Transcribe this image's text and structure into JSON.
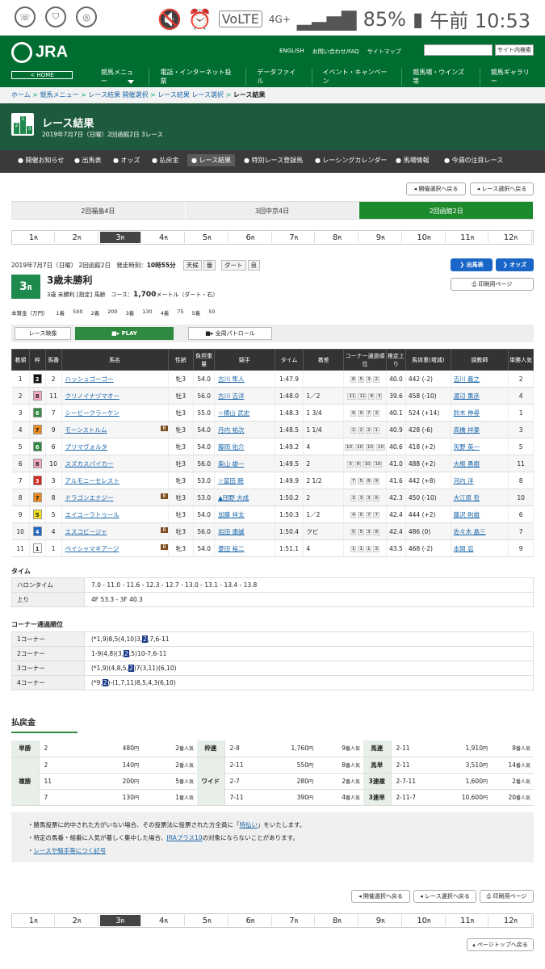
{
  "status": {
    "battery": "85%",
    "time": "午前 10:53",
    "net": "4G+",
    "volte": "VoLTE"
  },
  "header": {
    "logo": "JRA",
    "home": "< HOME",
    "links": [
      "ENGLISH",
      "お問い合わせ/FAQ",
      "サイトマップ"
    ],
    "search_btn": "サイト内検索",
    "nav": [
      "競馬メニュー",
      "電話・インターネット投票",
      "データファイル",
      "イベント・キャンペーン",
      "競馬場・ウインズ等",
      "競馬ギャラリー"
    ]
  },
  "breadcrumb": [
    "ホーム",
    "競馬メニュー",
    "レース結果 開催選択",
    "レース結果 レース選択",
    "レース結果"
  ],
  "page": {
    "title": "レース結果",
    "subtitle": "2019年7月7日（日曜）2回函館2日 3レース"
  },
  "subnav": [
    "開催お知らせ",
    "出馬表",
    "オッズ",
    "払戻金",
    "レース結果",
    "特別レース登録馬",
    "レーシングカレンダー",
    "馬場情報",
    "今週の注目レース"
  ],
  "nav_buttons": {
    "meet_back": "開催選択へ戻る",
    "race_back": "レース選択へ戻る",
    "print": "印刷用ページ",
    "page_top": "ページトップへ戻る"
  },
  "meetings": [
    "2回福島4日",
    "3回中京4日",
    "2回函館2日"
  ],
  "races": [
    "1",
    "2",
    "3",
    "4",
    "5",
    "6",
    "7",
    "8",
    "9",
    "10",
    "11",
    "12"
  ],
  "race_suffix": "R",
  "race": {
    "date_info": "2019年7月7日（日曜） 2回函館2日",
    "start_label": "発走時刻：",
    "start_time": "10時55分",
    "weather_label": "天候",
    "weather": "曇",
    "track_label": "ダート",
    "going": "良",
    "num": "3",
    "num_suffix": "R",
    "name": "3歳未勝利",
    "cond": "3歳 未勝利 [指定] 馬齢",
    "course_label": "コース：",
    "course": "1,700",
    "course_unit": "メートル（ダート・右）",
    "btn_entries": "出馬表",
    "btn_odds": "オッズ",
    "btn_print": "印刷用ページ"
  },
  "prizes": [
    "本賞金（万円）",
    "1着",
    "500",
    "2着",
    "200",
    "3着",
    "130",
    "4着",
    "75",
    "5着",
    "50"
  ],
  "video": {
    "label": "レース映像",
    "play": "PLAY",
    "patrol": "全周パトロール"
  },
  "table_headers": [
    "着順",
    "枠",
    "馬番",
    "馬名",
    "性齢",
    "負担重量",
    "騎手",
    "タイム",
    "着差",
    "コーナー通過順位",
    "推定上り",
    "馬体重(増減)",
    "調教師",
    "単勝人気"
  ],
  "results": [
    {
      "pos": "1",
      "waku": "2",
      "num": "2",
      "horse": "ハッシュゴーゴー",
      "b": "",
      "sex": "牝3",
      "wt": "54.0",
      "jockey": "古川 隼人",
      "time": "1:47.9",
      "margin": "",
      "corners": [
        "8",
        "5",
        "3",
        "2"
      ],
      "last": "40.0",
      "bw": "442 (-2)",
      "trainer": "吉川 義之",
      "pop": "2"
    },
    {
      "pos": "2",
      "waku": "8",
      "num": "11",
      "horse": "クリノイナヅマオー",
      "b": "",
      "sex": "牡3",
      "wt": "56.0",
      "jockey": "古川 吉洋",
      "time": "1:48.0",
      "margin": "1／2",
      "corners": [
        "11",
        "11",
        "8",
        "3"
      ],
      "last": "39.6",
      "bw": "458 (-10)",
      "trainer": "渡辺 薫彦",
      "pop": "4"
    },
    {
      "pos": "3",
      "waku": "6",
      "num": "7",
      "horse": "シービークラーケン",
      "b": "",
      "sex": "牡3",
      "wt": "55.0",
      "jockey": "☆横山 武史",
      "time": "1:48.3",
      "margin": "1 3/4",
      "corners": [
        "9",
        "9",
        "7",
        "3"
      ],
      "last": "40.1",
      "bw": "524 (+14)",
      "trainer": "鈴木 伸尋",
      "pop": "1"
    },
    {
      "pos": "4",
      "waku": "7",
      "num": "9",
      "horse": "モーンストルム",
      "b": "B",
      "sex": "牝3",
      "wt": "54.0",
      "jockey": "丹内 祐次",
      "time": "1:48.5",
      "margin": "1 1/4",
      "corners": [
        "2",
        "2",
        "2",
        "1"
      ],
      "last": "40.9",
      "bw": "428 (-6)",
      "trainer": "高橋 祥泰",
      "pop": "3"
    },
    {
      "pos": "5",
      "waku": "6",
      "num": "6",
      "horse": "プリマヴォルタ",
      "b": "",
      "sex": "牝3",
      "wt": "54.0",
      "jockey": "藤岡 佑介",
      "time": "1:49.2",
      "margin": "4",
      "corners": [
        "10",
        "10",
        "10",
        "10"
      ],
      "last": "40.6",
      "bw": "418 (+2)",
      "trainer": "矢野 英一",
      "pop": "5"
    },
    {
      "pos": "6",
      "waku": "8",
      "num": "10",
      "horse": "スズカスパイカー",
      "b": "",
      "sex": "牡3",
      "wt": "56.0",
      "jockey": "柴山 雄一",
      "time": "1:49.5",
      "margin": "2",
      "corners": [
        "5",
        "8",
        "10",
        "10"
      ],
      "last": "41.0",
      "bw": "488 (+2)",
      "trainer": "大根 勇樹",
      "pop": "11"
    },
    {
      "pos": "7",
      "waku": "3",
      "num": "3",
      "horse": "アルモニーセレスト",
      "b": "",
      "sex": "牝3",
      "wt": "53.0",
      "jockey": "☆富田 暁",
      "time": "1:49.9",
      "margin": "2 1/2",
      "corners": [
        "7",
        "5",
        "8",
        "9"
      ],
      "last": "41.6",
      "bw": "442 (+8)",
      "trainer": "河内 洋",
      "pop": "8"
    },
    {
      "pos": "8",
      "waku": "7",
      "num": "8",
      "horse": "ドラゴンエナジー",
      "b": "B",
      "sex": "牡3",
      "wt": "53.0",
      "jockey": "▲団野 大成",
      "time": "1:50.2",
      "margin": "2",
      "corners": [
        "3",
        "3",
        "3",
        "6"
      ],
      "last": "42.3",
      "bw": "450 (-10)",
      "trainer": "大江原 哲",
      "pop": "10"
    },
    {
      "pos": "9",
      "waku": "5",
      "num": "5",
      "horse": "エイユーラトゥール",
      "b": "",
      "sex": "牡3",
      "wt": "54.0",
      "jockey": "加藤 祥太",
      "time": "1:50.3",
      "margin": "1／2",
      "corners": [
        "4",
        "5",
        "7",
        "7"
      ],
      "last": "42.4",
      "bw": "444 (+2)",
      "trainer": "藤沢 則雄",
      "pop": "6"
    },
    {
      "pos": "10",
      "waku": "4",
      "num": "4",
      "horse": "エスコビージャ",
      "b": "B",
      "sex": "牡3",
      "wt": "56.0",
      "jockey": "岩田 康誠",
      "time": "1:50.4",
      "margin": "クビ",
      "corners": [
        "5",
        "5",
        "3",
        "8"
      ],
      "last": "42.4",
      "bw": "486 (0)",
      "trainer": "佐々木 晶三",
      "pop": "7"
    },
    {
      "pos": "11",
      "waku": "1",
      "num": "1",
      "horse": "ペイシャマキアージ",
      "b": "B",
      "sex": "牝3",
      "wt": "54.0",
      "jockey": "菱田 裕二",
      "time": "1:51.1",
      "margin": "4",
      "corners": [
        "1",
        "1",
        "1",
        "3"
      ],
      "last": "43.5",
      "bw": "468 (-2)",
      "trainer": "本間 忍",
      "pop": "9"
    }
  ],
  "waku_colors": {
    "1": "#ffffff",
    "2": "#111111",
    "3": "#d8281e",
    "4": "#1a66c8",
    "5": "#f5e11a",
    "6": "#2e8a3e",
    "7": "#f08a1a",
    "8": "#f3a8c0"
  },
  "times": {
    "title": "タイム",
    "rows": [
      {
        "k": "ハロンタイム",
        "v": "7.0 - 11.0 - 11.6 - 12.3 - 12.7 - 13.0 - 13.1 - 13.4 - 13.8"
      },
      {
        "k": "上り",
        "v": "4F 53.3 - 3F 40.3"
      }
    ]
  },
  "corners": {
    "title": "コーナー通過順位",
    "rows": [
      {
        "k": "1コーナー",
        "pre": "(*1,9)8,5(4,10)3,",
        "hl": "2",
        "post": ",7,6-11"
      },
      {
        "k": "2コーナー",
        "pre": "1-9(4,8)(3,",
        "hl": "2",
        "post": ",5)10-7,6-11"
      },
      {
        "k": "3コーナー",
        "pre": "(*1,9)(4,8,5,",
        "hl": "2",
        "post": ")7(3,11)(6,10)"
      },
      {
        "k": "4コーナー",
        "pre": "(*9,",
        "hl": "2",
        "post": ")-(1,7,11)8,5,4,3(6,10)"
      }
    ]
  },
  "payout": {
    "title": "払戻金",
    "yen": "円",
    "pop_suffix": "番人気",
    "tansho": {
      "label": "単勝",
      "rows": [
        {
          "c": "2",
          "y": "480",
          "p": "2"
        }
      ]
    },
    "fukusho": {
      "label": "複勝",
      "rows": [
        {
          "c": "2",
          "y": "140",
          "p": "2"
        },
        {
          "c": "11",
          "y": "200",
          "p": "5"
        },
        {
          "c": "7",
          "y": "130",
          "p": "1"
        }
      ]
    },
    "wakuren": {
      "label": "枠連",
      "rows": [
        {
          "c": "2-8",
          "y": "1,760",
          "p": "9"
        }
      ]
    },
    "wide": {
      "label": "ワイド",
      "rows": [
        {
          "c": "2-11",
          "y": "550",
          "p": "8"
        },
        {
          "c": "2-7",
          "y": "280",
          "p": "2"
        },
        {
          "c": "7-11",
          "y": "390",
          "p": "4"
        }
      ]
    },
    "umaren": {
      "label": "馬連",
      "rows": [
        {
          "c": "2-11",
          "y": "1,910",
          "p": "8"
        }
      ]
    },
    "umatan": {
      "label": "馬単",
      "rows": [
        {
          "c": "2-11",
          "y": "3,510",
          "p": "14"
        }
      ]
    },
    "sanrenpuku": {
      "label": "3連複",
      "rows": [
        {
          "c": "2-7-11",
          "y": "1,600",
          "p": "2"
        }
      ]
    },
    "sanrentan": {
      "label": "3連単",
      "rows": [
        {
          "c": "2-11-7",
          "y": "10,600",
          "p": "20"
        }
      ]
    }
  },
  "notes": {
    "n1a": "勝馬投票に的中された方がいない場合、その投票法に投票された方全員に「",
    "n1l": "特払い",
    "n1b": "」をいたします。",
    "n2a": "特定の馬番・組番に人気が著しく集中した場合、",
    "n2l": "JRAプラス10",
    "n2b": "の対象にならないことがあります。",
    "n3": "レースや騎手等につく記号"
  }
}
